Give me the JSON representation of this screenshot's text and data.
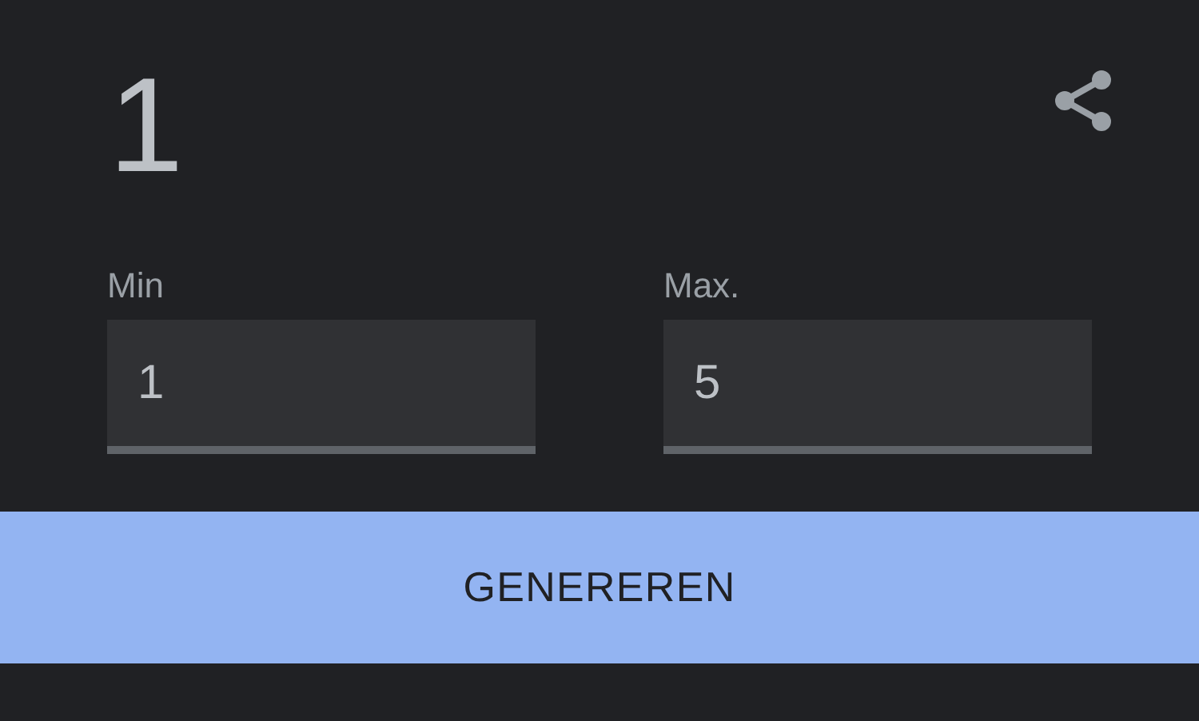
{
  "result": "1",
  "fields": [
    {
      "label": "Min",
      "value": "1"
    },
    {
      "label": "Max.",
      "value": "5"
    }
  ],
  "button": {
    "label": "GENEREREN"
  }
}
